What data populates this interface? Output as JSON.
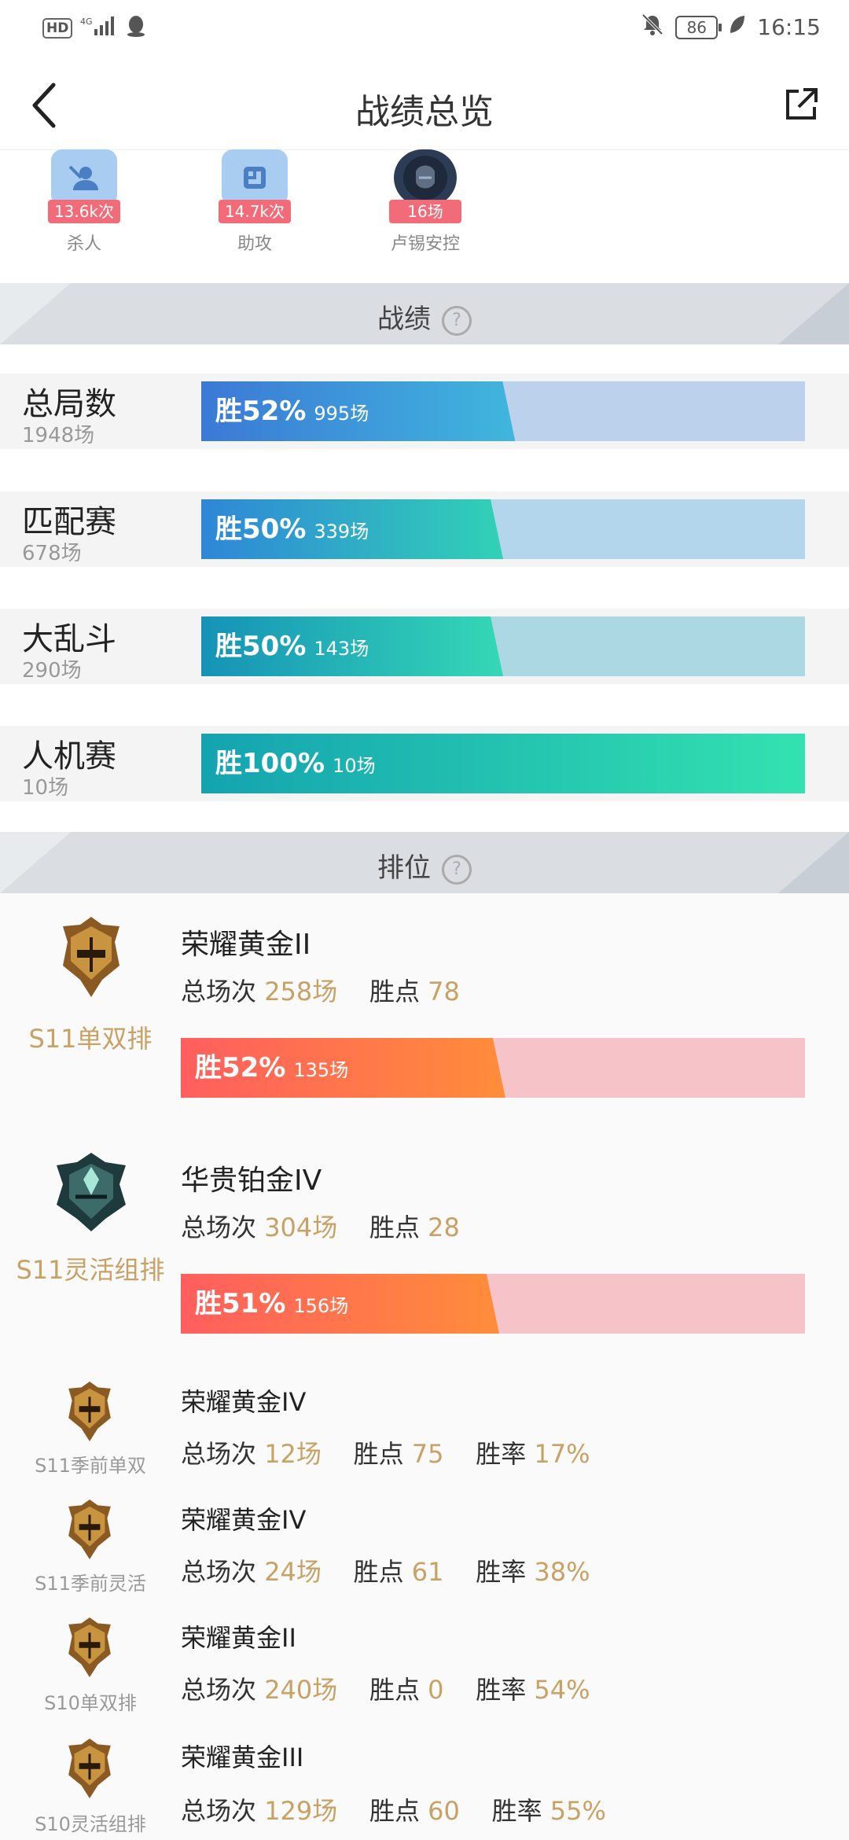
{
  "status_bar": {
    "left": "HD 4G",
    "battery": "86",
    "time": "16:15"
  },
  "header": {
    "title": "战绩总览"
  },
  "top_stats": [
    {
      "value": "13.6k次",
      "caption": "杀人",
      "icon": "kill-icon"
    },
    {
      "value": "14.7k次",
      "caption": "助攻",
      "icon": "assist-icon"
    },
    {
      "value": "16场",
      "caption": "卢锡安控",
      "icon": "champion-avatar"
    }
  ],
  "record_section": {
    "label": "战绩"
  },
  "modes": [
    {
      "name": "总局数",
      "count": "1948场",
      "win": "胜52%",
      "games": "995场",
      "win_pct": 52,
      "color_a": "#3b79d6",
      "color_b": "#40b6dd",
      "bg": "#bcd2ec"
    },
    {
      "name": "匹配赛",
      "count": "678场",
      "win": "胜50%",
      "games": "339场",
      "win_pct": 50,
      "color_a": "#2f86d8",
      "color_b": "#30d2b5",
      "bg": "#b4d6ec"
    },
    {
      "name": "大乱斗",
      "count": "290场",
      "win": "胜50%",
      "games": "143场",
      "win_pct": 50,
      "color_a": "#1592b7",
      "color_b": "#35d8b6",
      "bg": "#acd8e4"
    },
    {
      "name": "人机赛",
      "count": "10场",
      "win": "胜100%",
      "games": "10场",
      "win_pct": 100,
      "color_a": "#14a3b0",
      "color_b": "#33e2b0",
      "bg": "#acd8e4"
    }
  ],
  "rank_section": {
    "label": "排位"
  },
  "ranks_big": [
    {
      "season": "S11单双排",
      "tier": "荣耀黄金II",
      "total_label": "总场次",
      "total": "258场",
      "points_label": "胜点",
      "points": "78",
      "win": "胜52%",
      "games": "135场",
      "win_pct": 52,
      "emblem": "gold"
    },
    {
      "season": "S11灵活组排",
      "tier": "华贵铂金IV",
      "total_label": "总场次",
      "total": "304场",
      "points_label": "胜点",
      "points": "28",
      "win": "胜51%",
      "games": "156场",
      "win_pct": 51,
      "emblem": "platinum"
    }
  ],
  "ranks_small": [
    {
      "season": "S11季前单双",
      "tier": "荣耀黄金IV",
      "total_label": "总场次",
      "total": "12场",
      "points_label": "胜点",
      "points": "75",
      "rate_label": "胜率",
      "rate": "17%"
    },
    {
      "season": "S11季前灵活",
      "tier": "荣耀黄金IV",
      "total_label": "总场次",
      "total": "24场",
      "points_label": "胜点",
      "points": "61",
      "rate_label": "胜率",
      "rate": "38%"
    },
    {
      "season": "S10单双排",
      "tier": "荣耀黄金II",
      "total_label": "总场次",
      "total": "240场",
      "points_label": "胜点",
      "points": "0",
      "rate_label": "胜率",
      "rate": "54%"
    },
    {
      "season": "S10灵活组排",
      "tier": "荣耀黄金III",
      "total_label": "总场次",
      "total": "129场",
      "points_label": "胜点",
      "points": "60",
      "rate_label": "胜率",
      "rate": "55%"
    }
  ]
}
